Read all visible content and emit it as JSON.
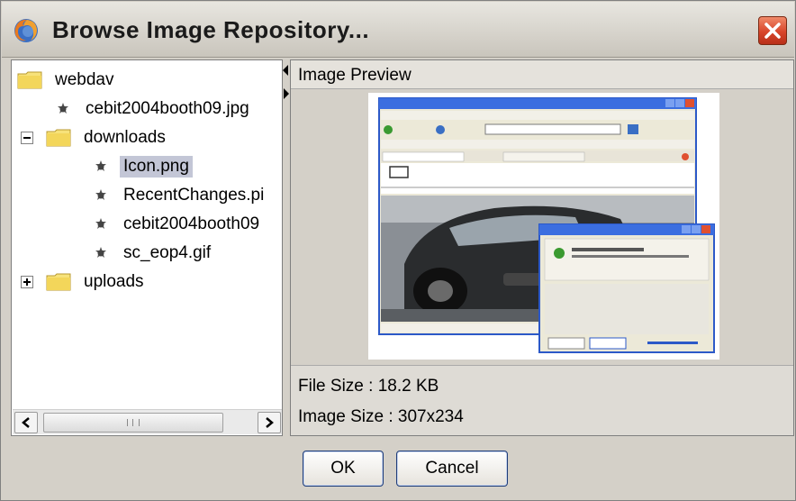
{
  "window": {
    "title": "Browse Image Repository...",
    "app_icon": "firefox-icon",
    "close_icon": "close-icon",
    "colors": {
      "close_button": "#d8452a",
      "selection": "#c3c6d6",
      "button_border": "#1e3c78"
    }
  },
  "tree": {
    "root": {
      "label": "webdav",
      "icon": "folder-icon"
    },
    "items": [
      {
        "label": "cebit2004booth09.jpg",
        "type": "file"
      },
      {
        "label": "downloads",
        "type": "folder",
        "expanded": true
      },
      {
        "label": "Icon.png",
        "type": "file",
        "selected": true
      },
      {
        "label": "RecentChanges.pi",
        "type": "file"
      },
      {
        "label": "cebit2004booth09",
        "type": "file"
      },
      {
        "label": "sc_eop4.gif",
        "type": "file"
      },
      {
        "label": "uploads",
        "type": "folder",
        "expanded": false
      }
    ]
  },
  "scrollbar": {
    "left_icon": "chevron-left-icon",
    "right_icon": "chevron-right-icon"
  },
  "preview": {
    "header": "Image Preview",
    "file_size_label": "File Size : 18.2 KB",
    "image_size_label": "Image Size : 307x234"
  },
  "buttons": {
    "ok": "OK",
    "cancel": "Cancel"
  }
}
